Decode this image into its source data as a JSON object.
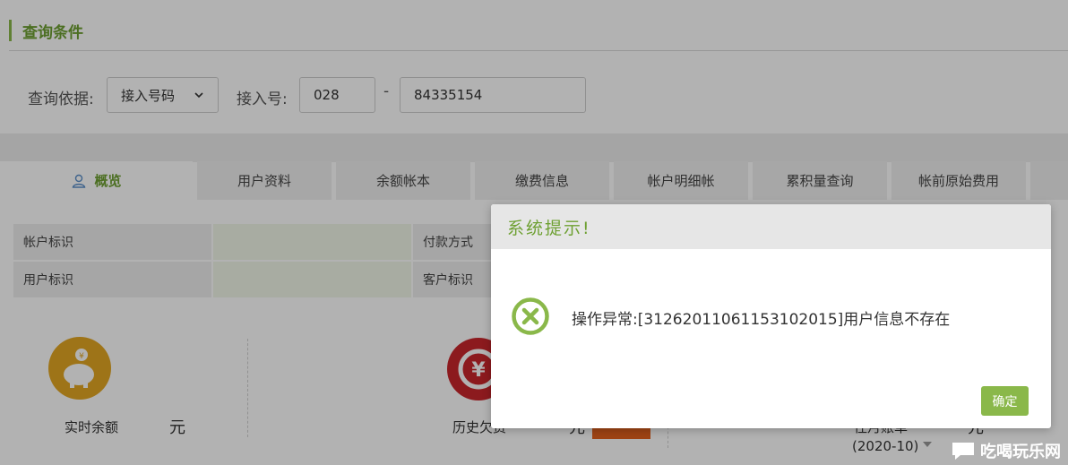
{
  "section": {
    "title": "查询条件"
  },
  "query": {
    "basis_label": "查询依据:",
    "basis_value": "接入号码",
    "access_label": "接入号:",
    "area_code": "028",
    "dash": "-",
    "number": "84335154"
  },
  "tabs": [
    {
      "label": "概览",
      "active": true
    },
    {
      "label": "用户资料"
    },
    {
      "label": "余额帐本"
    },
    {
      "label": "缴费信息"
    },
    {
      "label": "帐户明细帐"
    },
    {
      "label": "累积量查询"
    },
    {
      "label": "帐前原始费用"
    }
  ],
  "info": {
    "account_id_label": "帐户标识",
    "payment_method_label": "付款方式",
    "user_id_label": "用户标识",
    "customer_id_label": "客户标识"
  },
  "stats": {
    "balance_label": "实时余额",
    "balance_unit": "元",
    "history_label": "历史欠费",
    "history_unit": "元",
    "bill_label": "往月账单",
    "bill_unit": "元",
    "bill_month": "(2020-10)"
  },
  "dialog": {
    "title": "系统提示!",
    "message": "操作异常:[3126201106115310​2015]用户信息不存在",
    "ok_label": "确定"
  },
  "watermark": {
    "text": "吃喝玩乐网"
  },
  "colors": {
    "accent": "#8ab84a",
    "accent_text": "#6ea032",
    "gold": "#e3a623",
    "red": "#c9262c",
    "orange": "#e2611d"
  }
}
